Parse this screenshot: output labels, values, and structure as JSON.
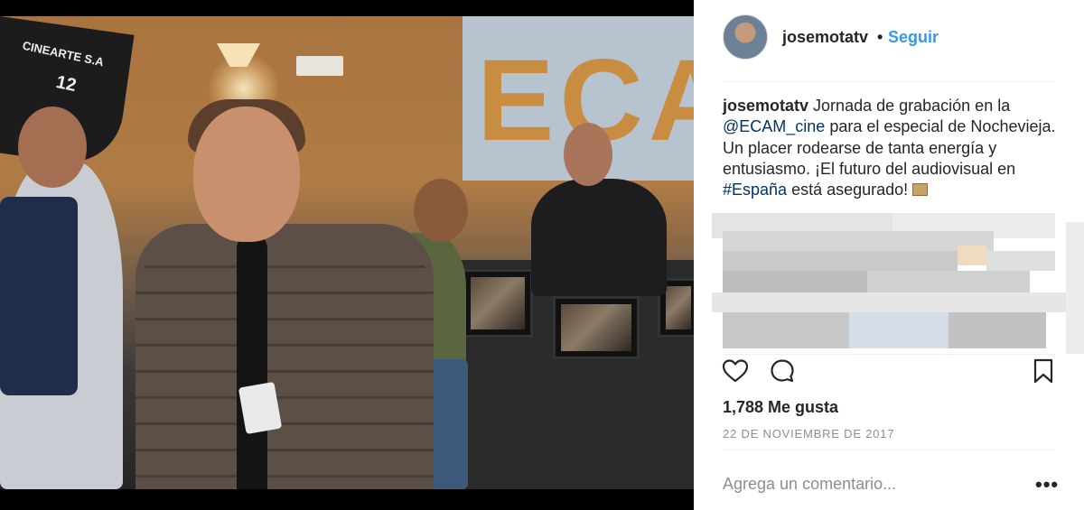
{
  "post": {
    "photo_sign_main": "ECAM",
    "photo_sign_equipment": "CINEARTE S.A",
    "photo_sign_number": "12"
  },
  "header": {
    "username": "josemotatv",
    "separator": "•",
    "follow_label": "Seguir",
    "avatar_icon": "avatar-icon"
  },
  "caption": {
    "username": "josemotatv",
    "text_1": "Jornada de grabación en la",
    "mention": "@ECAM_cine",
    "text_2": "para el especial de Nochevieja. Un placer rodearse de tanta energía y entusiasmo. ¡El futuro del audiovisual en",
    "hashtag": "#España",
    "text_3": "está asegurado!",
    "emoji_icon": "clapperboard-icon"
  },
  "actions": {
    "like_icon": "heart-icon",
    "comment_icon": "speech-bubble-icon",
    "save_icon": "bookmark-icon"
  },
  "likes_text": "1,788 Me gusta",
  "date_text": "22 DE NOVIEMBRE DE 2017",
  "comment": {
    "placeholder": "Agrega un comentario...",
    "more_label": "•••"
  },
  "colors": {
    "link_blue": "#3897f0",
    "text_dark": "#262626",
    "muted": "#8e8e8e",
    "mention": "#003569"
  }
}
